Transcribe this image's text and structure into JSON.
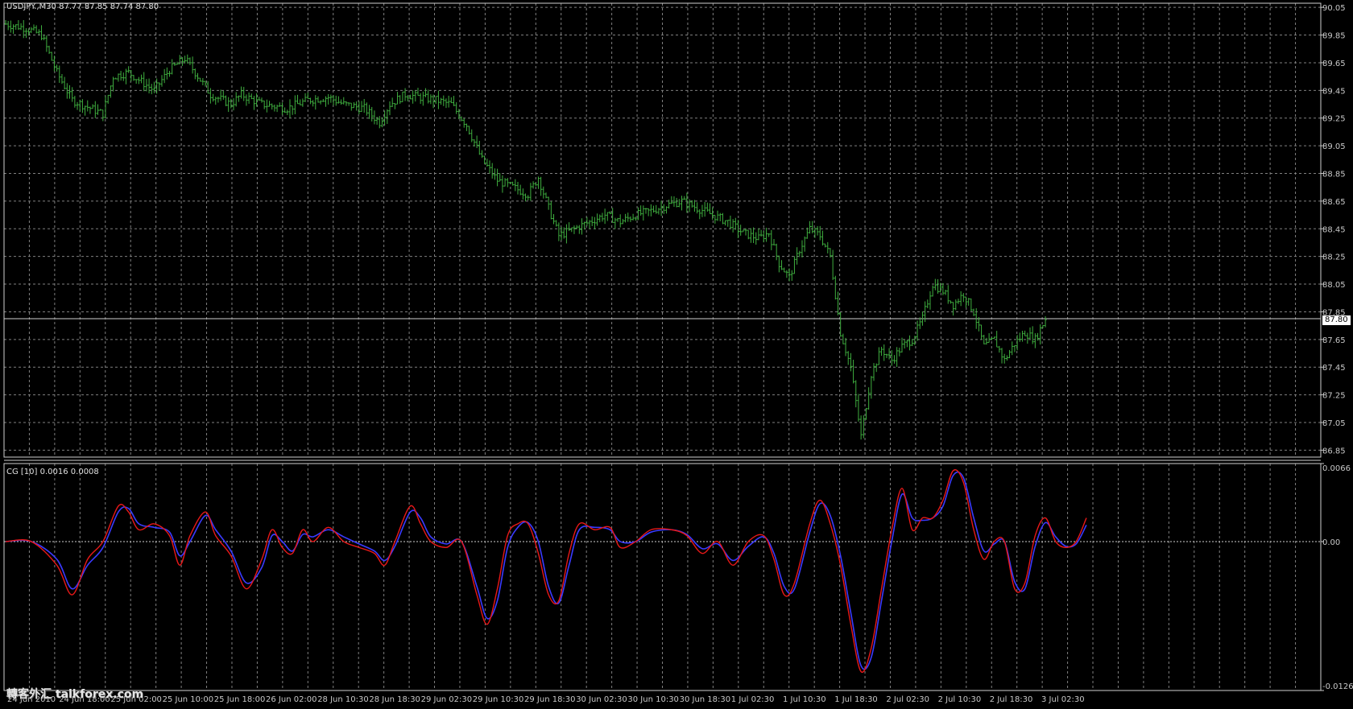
{
  "header": {
    "symbol_label": "USDJPY.,M30  87.77 87.85 87.74 87.80",
    "indicator_label": "CG [10] 0.0016 0.0008"
  },
  "current_price_tag": "87.80",
  "watermark": "轉客外汇 talkforex.com",
  "colors": {
    "background": "#000000",
    "grid": "#7f7f7f",
    "bars": "#3fae3f",
    "cg_line": "#e81818",
    "signal_line": "#3a3aff",
    "axis_text": "#c8c8c8"
  },
  "chart_data": [
    {
      "type": "bar",
      "name": "USDJPY M30 price",
      "ylim": [
        86.8,
        90.08
      ],
      "y_ticks": [
        "90.05",
        "89.85",
        "89.65",
        "89.45",
        "89.25",
        "89.05",
        "88.85",
        "88.65",
        "88.45",
        "88.25",
        "88.05",
        "87.85",
        "87.65",
        "87.45",
        "87.25",
        "87.05",
        "86.85"
      ],
      "current_price": 87.8,
      "close_path": [
        [
          0,
          89.93
        ],
        [
          8,
          89.9
        ],
        [
          14,
          89.85
        ],
        [
          20,
          89.58
        ],
        [
          26,
          89.38
        ],
        [
          32,
          89.33
        ],
        [
          38,
          89.28
        ],
        [
          42,
          89.55
        ],
        [
          48,
          89.58
        ],
        [
          54,
          89.5
        ],
        [
          58,
          89.45
        ],
        [
          64,
          89.6
        ],
        [
          70,
          89.68
        ],
        [
          74,
          89.58
        ],
        [
          80,
          89.42
        ],
        [
          88,
          89.35
        ],
        [
          92,
          89.42
        ],
        [
          100,
          89.35
        ],
        [
          110,
          89.32
        ],
        [
          118,
          89.38
        ],
        [
          126,
          89.4
        ],
        [
          132,
          89.35
        ],
        [
          140,
          89.32
        ],
        [
          146,
          89.22
        ],
        [
          150,
          89.35
        ],
        [
          156,
          89.42
        ],
        [
          162,
          89.4
        ],
        [
          168,
          89.38
        ],
        [
          174,
          89.35
        ],
        [
          180,
          89.2
        ],
        [
          186,
          88.95
        ],
        [
          192,
          88.8
        ],
        [
          198,
          88.75
        ],
        [
          204,
          88.7
        ],
        [
          208,
          88.82
        ],
        [
          212,
          88.6
        ],
        [
          216,
          88.4
        ],
        [
          222,
          88.45
        ],
        [
          228,
          88.5
        ],
        [
          234,
          88.55
        ],
        [
          240,
          88.5
        ],
        [
          246,
          88.55
        ],
        [
          252,
          88.58
        ],
        [
          258,
          88.62
        ],
        [
          264,
          88.65
        ],
        [
          270,
          88.6
        ],
        [
          276,
          88.55
        ],
        [
          282,
          88.5
        ],
        [
          288,
          88.42
        ],
        [
          294,
          88.38
        ],
        [
          298,
          88.42
        ],
        [
          302,
          88.2
        ],
        [
          306,
          88.1
        ],
        [
          310,
          88.3
        ],
        [
          314,
          88.45
        ],
        [
          318,
          88.4
        ],
        [
          322,
          88.25
        ],
        [
          326,
          87.7
        ],
        [
          330,
          87.45
        ],
        [
          334,
          86.95
        ],
        [
          338,
          87.4
        ],
        [
          342,
          87.58
        ],
        [
          346,
          87.5
        ],
        [
          350,
          87.6
        ],
        [
          354,
          87.65
        ],
        [
          358,
          87.8
        ],
        [
          362,
          88.05
        ],
        [
          366,
          88.0
        ],
        [
          370,
          87.9
        ],
        [
          374,
          87.98
        ],
        [
          378,
          87.85
        ],
        [
          382,
          87.6
        ],
        [
          386,
          87.65
        ],
        [
          390,
          87.5
        ],
        [
          394,
          87.62
        ],
        [
          398,
          87.7
        ],
        [
          402,
          87.65
        ],
        [
          406,
          87.8
        ]
      ],
      "x_ticks": [
        "24 Jun 2010",
        "24 Jun 18:00",
        "25 Jun 02:00",
        "25 Jun 10:00",
        "25 Jun 18:00",
        "26 Jun 02:00",
        "28 Jun 10:30",
        "28 Jun 18:30",
        "29 Jun 02:30",
        "29 Jun 10:30",
        "29 Jun 18:30",
        "30 Jun 02:30",
        "30 Jun 10:30",
        "30 Jun 18:30",
        "1 Jul 02:30",
        "1 Jul 10:30",
        "1 Jul 18:30",
        "2 Jul 02:30",
        "2 Jul 10:30",
        "2 Jul 18:30",
        "3 Jul 02:30"
      ]
    },
    {
      "type": "line",
      "name": "CG [10]",
      "ylim": [
        -0.0126,
        0.0066
      ],
      "y_ticks": [
        "0.0066",
        "0.00",
        "-0.0126"
      ],
      "zero_line": 0.0,
      "series": [
        {
          "name": "CG",
          "points": [
            [
              0,
              0.0
            ],
            [
              10,
              0.0
            ],
            [
              20,
              -0.002
            ],
            [
              26,
              -0.0045
            ],
            [
              32,
              -0.0015
            ],
            [
              38,
              0.0
            ],
            [
              44,
              0.003
            ],
            [
              48,
              0.0025
            ],
            [
              52,
              0.001
            ],
            [
              58,
              0.0015
            ],
            [
              64,
              0.0005
            ],
            [
              68,
              -0.002
            ],
            [
              72,
              0.0005
            ],
            [
              78,
              0.0025
            ],
            [
              82,
              0.0005
            ],
            [
              88,
              -0.0012
            ],
            [
              94,
              -0.004
            ],
            [
              100,
              -0.0015
            ],
            [
              104,
              0.001
            ],
            [
              108,
              -0.0005
            ],
            [
              112,
              -0.001
            ],
            [
              116,
              0.001
            ],
            [
              120,
              0.0
            ],
            [
              126,
              0.0012
            ],
            [
              132,
              0.0
            ],
            [
              138,
              -0.0005
            ],
            [
              144,
              -0.001
            ],
            [
              148,
              -0.002
            ],
            [
              152,
              0.0
            ],
            [
              158,
              0.003
            ],
            [
              162,
              0.0015
            ],
            [
              166,
              0.0
            ],
            [
              172,
              -0.0005
            ],
            [
              178,
              0.0
            ],
            [
              184,
              -0.0045
            ],
            [
              188,
              -0.007
            ],
            [
              192,
              -0.004
            ],
            [
              196,
              0.0005
            ],
            [
              200,
              0.0015
            ],
            [
              204,
              0.0015
            ],
            [
              208,
              -0.001
            ],
            [
              212,
              -0.0045
            ],
            [
              216,
              -0.005
            ],
            [
              220,
              -0.001
            ],
            [
              224,
              0.0015
            ],
            [
              230,
              0.001
            ],
            [
              236,
              0.0012
            ],
            [
              240,
              -0.0005
            ],
            [
              246,
              0.0
            ],
            [
              252,
              0.001
            ],
            [
              260,
              0.001
            ],
            [
              266,
              0.0005
            ],
            [
              272,
              -0.001
            ],
            [
              278,
              0.0
            ],
            [
              284,
              -0.002
            ],
            [
              290,
              0.0
            ],
            [
              296,
              0.0005
            ],
            [
              300,
              -0.0015
            ],
            [
              304,
              -0.0045
            ],
            [
              308,
              -0.0035
            ],
            [
              314,
              0.0015
            ],
            [
              318,
              0.0035
            ],
            [
              322,
              0.0015
            ],
            [
              326,
              -0.002
            ],
            [
              330,
              -0.007
            ],
            [
              334,
              -0.011
            ],
            [
              338,
              -0.009
            ],
            [
              342,
              -0.004
            ],
            [
              346,
              0.001
            ],
            [
              350,
              0.0045
            ],
            [
              354,
              0.001
            ],
            [
              358,
              0.002
            ],
            [
              362,
              0.002
            ],
            [
              366,
              0.0035
            ],
            [
              370,
              0.006
            ],
            [
              374,
              0.005
            ],
            [
              378,
              0.001
            ],
            [
              382,
              -0.0015
            ],
            [
              386,
              0.0
            ],
            [
              390,
              0.0
            ],
            [
              394,
              -0.004
            ],
            [
              398,
              -0.0035
            ],
            [
              402,
              0.0005
            ],
            [
              406,
              0.002
            ],
            [
              410,
              0.0
            ],
            [
              414,
              -0.0005
            ],
            [
              418,
              0.0
            ],
            [
              422,
              0.002
            ]
          ]
        },
        {
          "name": "Signal",
          "points": [
            [
              0,
              0.0
            ],
            [
              10,
              0.0
            ],
            [
              20,
              -0.0015
            ],
            [
              26,
              -0.004
            ],
            [
              32,
              -0.002
            ],
            [
              38,
              -0.0005
            ],
            [
              44,
              0.0025
            ],
            [
              48,
              0.0028
            ],
            [
              52,
              0.0015
            ],
            [
              58,
              0.0012
            ],
            [
              64,
              0.0008
            ],
            [
              68,
              -0.0012
            ],
            [
              72,
              0.0
            ],
            [
              78,
              0.0022
            ],
            [
              82,
              0.001
            ],
            [
              88,
              -0.0008
            ],
            [
              94,
              -0.0035
            ],
            [
              100,
              -0.0022
            ],
            [
              104,
              0.0005
            ],
            [
              108,
              0.0
            ],
            [
              112,
              -0.0008
            ],
            [
              116,
              0.0006
            ],
            [
              120,
              0.0004
            ],
            [
              126,
              0.001
            ],
            [
              132,
              0.0004
            ],
            [
              138,
              -0.0002
            ],
            [
              144,
              -0.0008
            ],
            [
              148,
              -0.0016
            ],
            [
              152,
              -0.0004
            ],
            [
              158,
              0.0025
            ],
            [
              162,
              0.002
            ],
            [
              166,
              0.0004
            ],
            [
              172,
              -0.0002
            ],
            [
              178,
              0.0
            ],
            [
              184,
              -0.0038
            ],
            [
              188,
              -0.0065
            ],
            [
              192,
              -0.005
            ],
            [
              196,
              -0.0005
            ],
            [
              200,
              0.0012
            ],
            [
              204,
              0.0016
            ],
            [
              208,
              0.0
            ],
            [
              212,
              -0.0038
            ],
            [
              216,
              -0.0052
            ],
            [
              220,
              -0.002
            ],
            [
              224,
              0.001
            ],
            [
              230,
              0.0012
            ],
            [
              236,
              0.001
            ],
            [
              240,
              0.0
            ],
            [
              246,
              0.0
            ],
            [
              252,
              0.0008
            ],
            [
              260,
              0.001
            ],
            [
              266,
              0.0006
            ],
            [
              272,
              -0.0006
            ],
            [
              278,
              -0.0002
            ],
            [
              284,
              -0.0016
            ],
            [
              290,
              -0.0004
            ],
            [
              296,
              0.0004
            ],
            [
              300,
              -0.001
            ],
            [
              304,
              -0.0038
            ],
            [
              308,
              -0.004
            ],
            [
              314,
              0.0008
            ],
            [
              318,
              0.0032
            ],
            [
              322,
              0.0022
            ],
            [
              326,
              -0.0012
            ],
            [
              330,
              -0.006
            ],
            [
              334,
              -0.0105
            ],
            [
              338,
              -0.0098
            ],
            [
              342,
              -0.005
            ],
            [
              346,
              0.0
            ],
            [
              350,
              0.004
            ],
            [
              354,
              0.002
            ],
            [
              358,
              0.0018
            ],
            [
              362,
              0.002
            ],
            [
              366,
              0.003
            ],
            [
              370,
              0.0056
            ],
            [
              374,
              0.0054
            ],
            [
              378,
              0.002
            ],
            [
              382,
              -0.0008
            ],
            [
              386,
              -0.0002
            ],
            [
              390,
              0.0
            ],
            [
              394,
              -0.0034
            ],
            [
              398,
              -0.004
            ],
            [
              402,
              -0.0004
            ],
            [
              406,
              0.0016
            ],
            [
              410,
              0.0004
            ],
            [
              414,
              -0.0004
            ],
            [
              418,
              -0.0002
            ],
            [
              422,
              0.0014
            ]
          ]
        }
      ]
    }
  ]
}
